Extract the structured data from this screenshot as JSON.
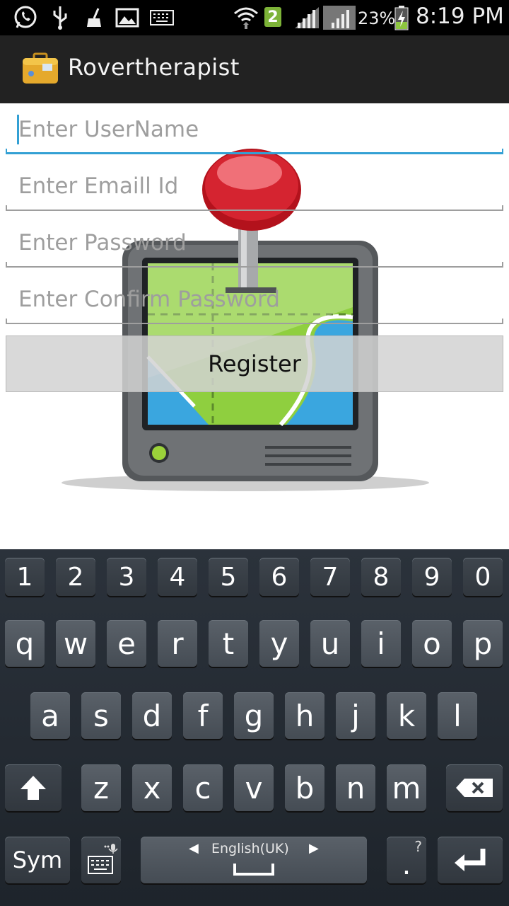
{
  "status_bar": {
    "battery_percent": "23%",
    "time": "8:19 PM",
    "sim_badge": "2",
    "icons": [
      "whatsapp-icon",
      "usb-icon",
      "broom-icon",
      "image-icon",
      "keyboard-icon",
      "wifi-icon",
      "signal-icon",
      "battery-charging-icon"
    ]
  },
  "action_bar": {
    "title": "Rovertherapist",
    "icon": "suitcase-icon"
  },
  "form": {
    "username_placeholder": "Enter UserName",
    "email_placeholder": "Enter Emaill Id",
    "password_placeholder": "Enter Password",
    "confirm_password_placeholder": "Enter Confirm Password",
    "register_label": "Register",
    "background_art": "gps-map-pin-icon"
  },
  "keyboard": {
    "numbers": [
      "1",
      "2",
      "3",
      "4",
      "5",
      "6",
      "7",
      "8",
      "9",
      "0"
    ],
    "row1": [
      "q",
      "w",
      "e",
      "r",
      "t",
      "y",
      "u",
      "i",
      "o",
      "p"
    ],
    "row2": [
      "a",
      "s",
      "d",
      "f",
      "g",
      "h",
      "j",
      "k",
      "l"
    ],
    "row3": [
      "z",
      "x",
      "c",
      "v",
      "b",
      "n",
      "m"
    ],
    "sym_label": "Sym",
    "space_label": "English(UK)",
    "period_label": ".",
    "period_sub": "?"
  },
  "colors": {
    "accent": "#33a0d4",
    "action_bar": "#222222",
    "keyboard_bg": "#232a31"
  }
}
